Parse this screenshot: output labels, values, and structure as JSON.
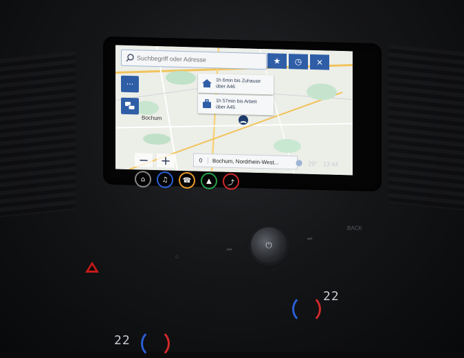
{
  "search": {
    "placeholder": "Suchbegriff oder Adresse"
  },
  "toolbar": {
    "favorite_icon": "star-icon",
    "history_icon": "clock-icon",
    "close_label": "×"
  },
  "side_buttons": {
    "menu_label": "···",
    "traffic_icon": "traffic-icon"
  },
  "routes": [
    {
      "icon": "home-icon",
      "line1": "1h 6min bis Zuhause",
      "line2": "über A46"
    },
    {
      "icon": "briefcase-icon",
      "line1": "1h 57min bis Arbeit",
      "line2": "über A45"
    }
  ],
  "map": {
    "city_label": "Bochum"
  },
  "bottom": {
    "zoom_out": "−",
    "zoom_in": "+",
    "count": "0",
    "address": "Bochum, Nordrhein-West..."
  },
  "status": {
    "temperature": "29°",
    "time": "13:44"
  },
  "apps": [
    {
      "name": "home-app",
      "glyph": "⌂",
      "color": "#0b0b0c"
    },
    {
      "name": "audio-app",
      "glyph": "♫",
      "color": "#2b5fd6"
    },
    {
      "name": "phone-app",
      "glyph": "☎",
      "color": "#e79a2a"
    },
    {
      "name": "navigation-app",
      "glyph": "▲",
      "color": "#26a34c"
    },
    {
      "name": "onstar-app",
      "glyph": "⤴",
      "color": "#d12a2a"
    }
  ],
  "climate": {
    "left_temp": "22",
    "right_temp": "22"
  },
  "controls": {
    "back_label": "BACK"
  }
}
